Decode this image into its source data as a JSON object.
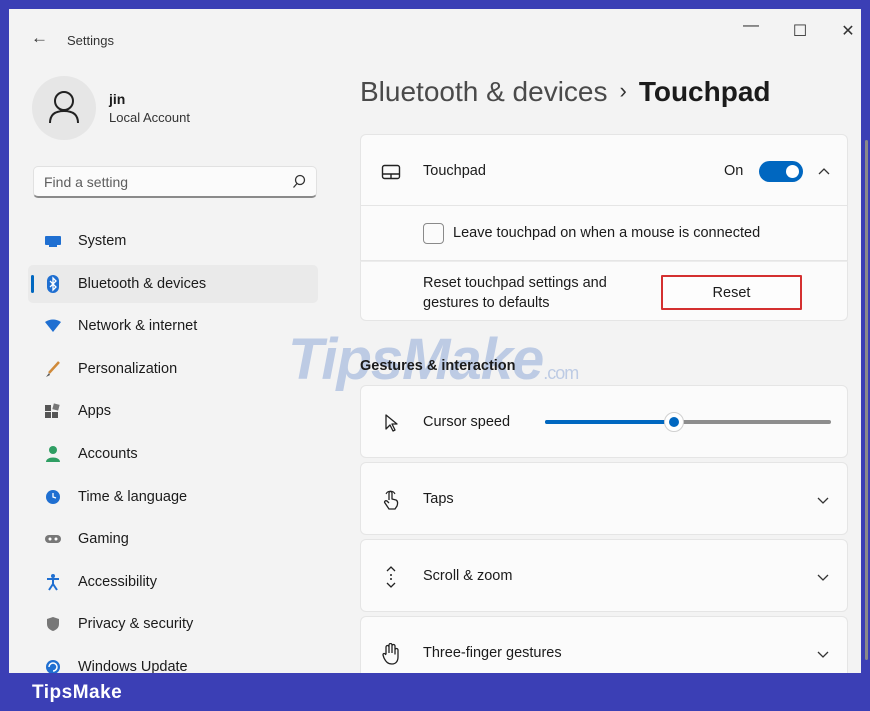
{
  "window": {
    "back_label": "←",
    "title": "Settings",
    "minimize": "—",
    "maximize": "☐",
    "close": "✕"
  },
  "profile": {
    "name": "jin",
    "account_type": "Local Account"
  },
  "search": {
    "placeholder": "Find a setting"
  },
  "nav": {
    "items": [
      {
        "label": "System",
        "icon": "monitor-icon",
        "selected": false
      },
      {
        "label": "Bluetooth & devices",
        "icon": "bluetooth-icon",
        "selected": true
      },
      {
        "label": "Network & internet",
        "icon": "wifi-icon",
        "selected": false
      },
      {
        "label": "Personalization",
        "icon": "brush-icon",
        "selected": false
      },
      {
        "label": "Apps",
        "icon": "apps-icon",
        "selected": false
      },
      {
        "label": "Accounts",
        "icon": "person-icon",
        "selected": false
      },
      {
        "label": "Time & language",
        "icon": "globe-clock-icon",
        "selected": false
      },
      {
        "label": "Gaming",
        "icon": "gamepad-icon",
        "selected": false
      },
      {
        "label": "Accessibility",
        "icon": "accessibility-icon",
        "selected": false
      },
      {
        "label": "Privacy & security",
        "icon": "shield-icon",
        "selected": false
      },
      {
        "label": "Windows Update",
        "icon": "update-icon",
        "selected": false
      }
    ]
  },
  "breadcrumb": {
    "parent": "Bluetooth & devices",
    "separator": "›",
    "current": "Touchpad"
  },
  "touchpad": {
    "label": "Touchpad",
    "toggle_state": "On",
    "leave_on_label": "Leave touchpad on when a mouse is connected",
    "leave_on_checked": false,
    "reset_text": "Reset touchpad settings and gestures to defaults",
    "reset_button": "Reset"
  },
  "gestures": {
    "section_title": "Gestures & interaction",
    "cursor_speed_label": "Cursor speed",
    "cursor_speed_fraction": 0.45,
    "taps_label": "Taps",
    "scroll_zoom_label": "Scroll & zoom",
    "three_finger_label": "Three-finger gestures"
  },
  "watermark": {
    "text": "TipsMake",
    "domain": ".com"
  },
  "footer": {
    "brand": "TipsMake"
  },
  "colors": {
    "accent": "#0067c0",
    "frame": "#3b3fb5",
    "highlight": "#d43030"
  }
}
